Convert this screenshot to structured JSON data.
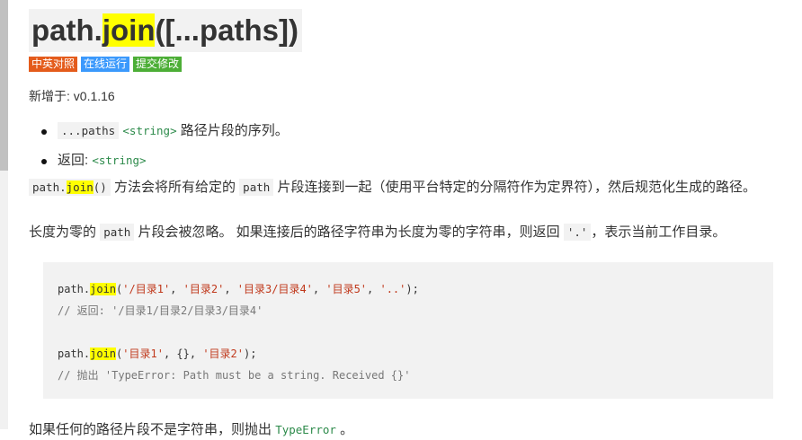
{
  "heading": {
    "prefix": "path.",
    "highlight": "join",
    "suffix": "([...paths])"
  },
  "badges": [
    "中英对照",
    "在线运行",
    "提交修改"
  ],
  "added": "新增于: v0.1.16",
  "params": [
    {
      "code": "...paths",
      "type": "<string>",
      "desc": "路径片段的序列。"
    },
    {
      "label": "返回:",
      "type": "<string>"
    }
  ],
  "para1": {
    "code_prefix": "path.",
    "code_hl": "join",
    "code_suffix": "()",
    "text1": "方法会将所有给定的",
    "code2": "path",
    "text2": "片段连接到一起（使用平台特定的分隔符作为定界符），然后规范化生成的路径。"
  },
  "para2": {
    "text1": "长度为零的",
    "code1": "path",
    "text2": "片段会被忽略。 如果连接后的路径字符串为长度为零的字符串，则返回",
    "code2": "'.'",
    "text3": "，表示当前工作目录。"
  },
  "code_block": {
    "line1": {
      "prefix": "path.",
      "hl": "join",
      "open": "(",
      "args": [
        "'/目录1'",
        "'目录2'",
        "'目录3/目录4'",
        "'目录5'",
        "'..'"
      ],
      "close": ");"
    },
    "comment1": "// 返回: '/目录1/目录2/目录3/目录4'",
    "line2": {
      "prefix": "path.",
      "hl": "join",
      "open": "(",
      "arg1": "'目录1'",
      "arg2": "{}",
      "arg3": "'目录2'",
      "close": ");"
    },
    "comment2": "// 抛出 'TypeError: Path must be a string. Received {}'"
  },
  "para3": {
    "text1": "如果任何的路径片段不是字符串，则抛出",
    "type": "TypeError",
    "text2": "。"
  },
  "colors": {
    "highlight": "#ffff00",
    "string": "#c0381b",
    "type": "#2c8a4a",
    "badge1": "#e45b1b",
    "badge2": "#3b99fc",
    "badge3": "#4cae36"
  }
}
